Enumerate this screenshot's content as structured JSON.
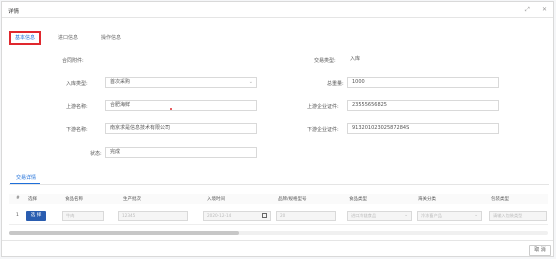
{
  "window": {
    "title": "详情",
    "icon_expand": "⤢",
    "icon_close": "✕"
  },
  "tabs": [
    "基本信息",
    "进口信息",
    "操作信息"
  ],
  "form": {
    "contract_label": "合同附件:",
    "trade_type_label": "交易类型:",
    "trade_type_value": "入库",
    "inbound_type_label": "入库类型:",
    "inbound_type_value": "首次采购",
    "total_weight_label": "总重量:",
    "total_weight_value": "1000",
    "upstream_name_label": "上游名称:",
    "upstream_name_value": "合肥海鲜",
    "upstream_cert_label": "上游企业证件:",
    "upstream_cert_value": "23555656825",
    "downstream_name_label": "下游名称:",
    "downstream_name_value": "南京求是信息技术有限公司",
    "downstream_cert_label": "下游企业证件:",
    "downstream_cert_value": "91320102302587284S",
    "status_label": "状态:",
    "status_value": "完成"
  },
  "detail_tab": "交易详情",
  "table": {
    "headers": [
      "#",
      "选择",
      "食品名称",
      "生产批次",
      "入境时间",
      "品牌/规格型号",
      "食品类型",
      "海关分类",
      "包装类型"
    ],
    "row": {
      "index": "1",
      "choose": "选 择",
      "food_name": "牛肉",
      "batch": "12345",
      "entry_time": "2020-12-14",
      "brand": "20",
      "food_type": "进口冷链食品",
      "customs": "冷冻畜产品",
      "package": "请输入包装类型"
    }
  },
  "footer": {
    "cancel": "取 消"
  },
  "colors": {
    "accent": "#1e6fd9",
    "highlight": "#e0282e",
    "button": "#2a5db0"
  }
}
